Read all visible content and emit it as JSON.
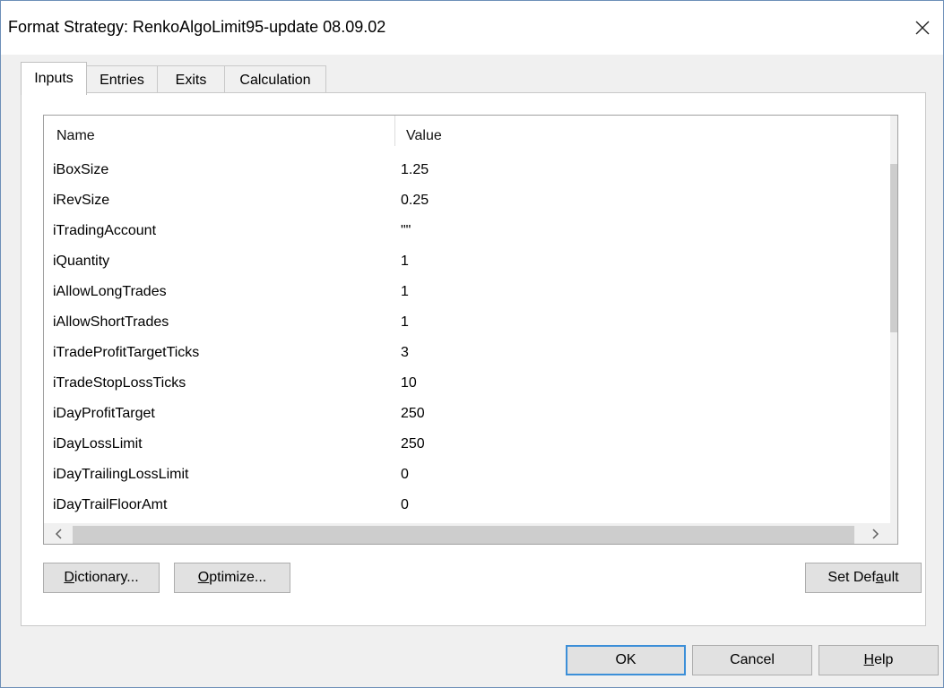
{
  "window": {
    "title": "Format Strategy: RenkoAlgoLimit95-update 08.09.02"
  },
  "tabs": [
    {
      "label": "Inputs",
      "active": true
    },
    {
      "label": "Entries",
      "active": false
    },
    {
      "label": "Exits",
      "active": false
    },
    {
      "label": "Calculation",
      "active": false
    }
  ],
  "grid": {
    "columns": [
      "Name",
      "Value"
    ],
    "rows": [
      {
        "name": "iBoxSize",
        "value": "1.25"
      },
      {
        "name": "iRevSize",
        "value": "0.25"
      },
      {
        "name": "iTradingAccount",
        "value": "\"\""
      },
      {
        "name": "iQuantity",
        "value": "1"
      },
      {
        "name": "iAllowLongTrades",
        "value": "1"
      },
      {
        "name": "iAllowShortTrades",
        "value": "1"
      },
      {
        "name": "iTradeProfitTargetTicks",
        "value": "3"
      },
      {
        "name": "iTradeStopLossTicks",
        "value": "10"
      },
      {
        "name": "iDayProfitTarget",
        "value": "250"
      },
      {
        "name": "iDayLossLimit",
        "value": "250"
      },
      {
        "name": "iDayTrailingLossLimit",
        "value": "0"
      },
      {
        "name": "iDayTrailFloorAmt",
        "value": "0"
      }
    ]
  },
  "buttons": {
    "dictionary": {
      "accel": "D",
      "rest": "ictionary..."
    },
    "optimize": {
      "accel": "O",
      "rest": "ptimize..."
    },
    "set_default": {
      "pre": "Set Def",
      "accel": "a",
      "post": "ult"
    },
    "ok": "OK",
    "cancel": "Cancel",
    "help": {
      "accel": "H",
      "rest": "elp"
    }
  },
  "icons": {
    "close": "close-icon",
    "scroll_up": "chevron-up-icon",
    "scroll_down": "chevron-down-icon",
    "scroll_left": "chevron-left-icon",
    "scroll_right": "chevron-right-icon"
  },
  "colors": {
    "dialog_bg": "#f0f0f0",
    "default_button_border": "#3c8fd8",
    "window_border": "#6d8fb8"
  }
}
